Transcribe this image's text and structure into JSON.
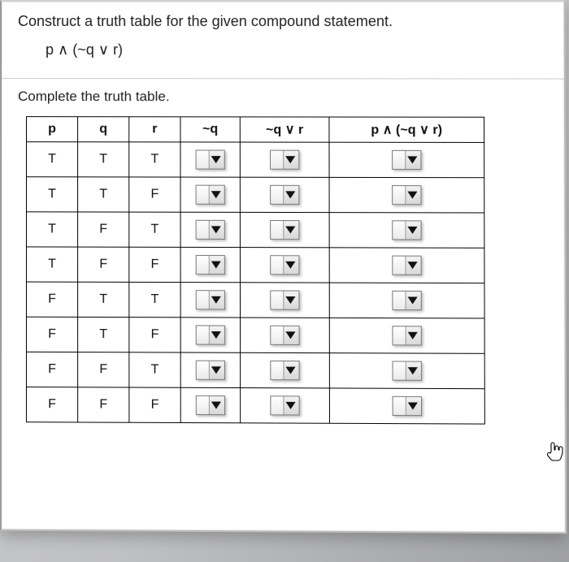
{
  "header": {
    "instruction": "Construct a truth table for the given compound statement.",
    "expression": "p ∧ (~q ∨ r)",
    "subtitle": "Complete the truth table."
  },
  "table": {
    "columns": [
      "p",
      "q",
      "r",
      "~q",
      "~q ∨ r",
      "p ∧ (~q ∨ r)"
    ],
    "rows": [
      {
        "p": "T",
        "q": "T",
        "r": "T"
      },
      {
        "p": "T",
        "q": "T",
        "r": "F"
      },
      {
        "p": "T",
        "q": "F",
        "r": "T"
      },
      {
        "p": "T",
        "q": "F",
        "r": "F"
      },
      {
        "p": "F",
        "q": "T",
        "r": "T"
      },
      {
        "p": "F",
        "q": "T",
        "r": "F"
      },
      {
        "p": "F",
        "q": "F",
        "r": "T"
      },
      {
        "p": "F",
        "q": "F",
        "r": "F"
      }
    ]
  },
  "icons": {
    "cursor": "pointer-hand-icon"
  }
}
